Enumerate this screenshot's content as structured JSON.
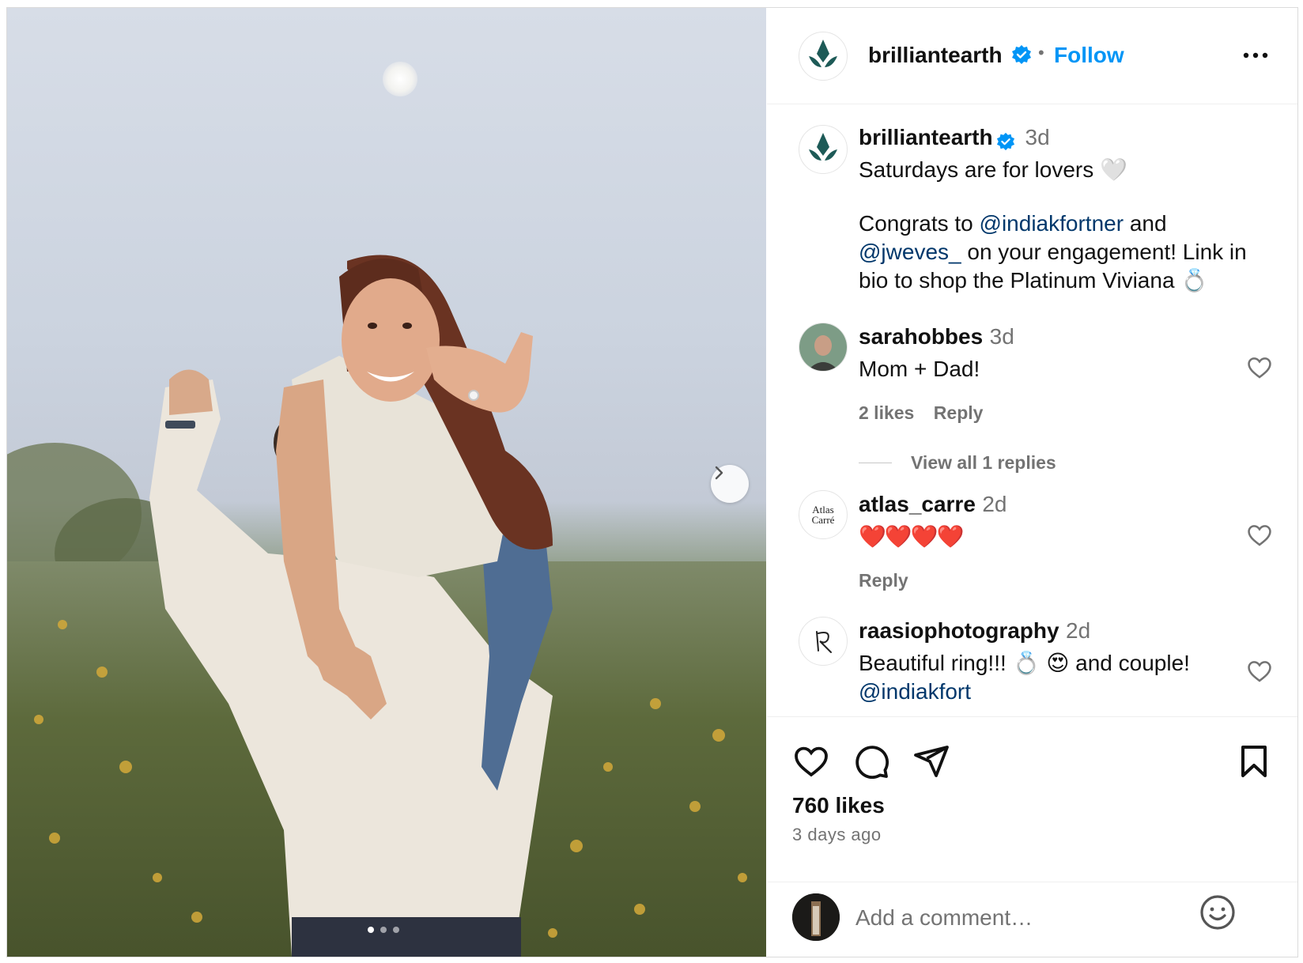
{
  "post": {
    "photo_alt": "",
    "carousel": {
      "count": 3,
      "active": 0
    }
  },
  "header": {
    "username": "brilliantearth",
    "separator": "•",
    "follow_label": "Follow"
  },
  "caption": {
    "username": "brilliantearth",
    "time": "3d",
    "line1": "Saturdays are for lovers 🤍",
    "congrats": "Congrats to ",
    "mention1": "@indiakfortner",
    "and": " and",
    "mention2": "@jweves_",
    "rest1": " on your engagement! Link in",
    "rest2": "bio to shop the Platinum Viviana 💍"
  },
  "comments": [
    {
      "username": "sarahobbes",
      "time": "3d",
      "text": "Mom + Dad!",
      "likes": "2 likes",
      "reply": "Reply",
      "view_replies": "View all 1 replies"
    },
    {
      "username": "atlas_carre",
      "time": "2d",
      "text": "❤️❤️❤️❤️",
      "reply": "Reply",
      "avatar_text_1": "Atlas",
      "avatar_text_2": "Carré"
    },
    {
      "username": "raasiophotography",
      "time": "2d",
      "text": "Beautiful ring!!! 💍 😍 and couple!",
      "partial": "@indiakfort"
    }
  ],
  "actions": {
    "likes": "760 likes",
    "ago": "3 days ago"
  },
  "add_comment": {
    "placeholder": "Add a comment…"
  },
  "colors": {
    "link_blue": "#0095f6",
    "mention": "#00376b",
    "muted": "#737373",
    "brand_teal": "#1d5a57"
  }
}
